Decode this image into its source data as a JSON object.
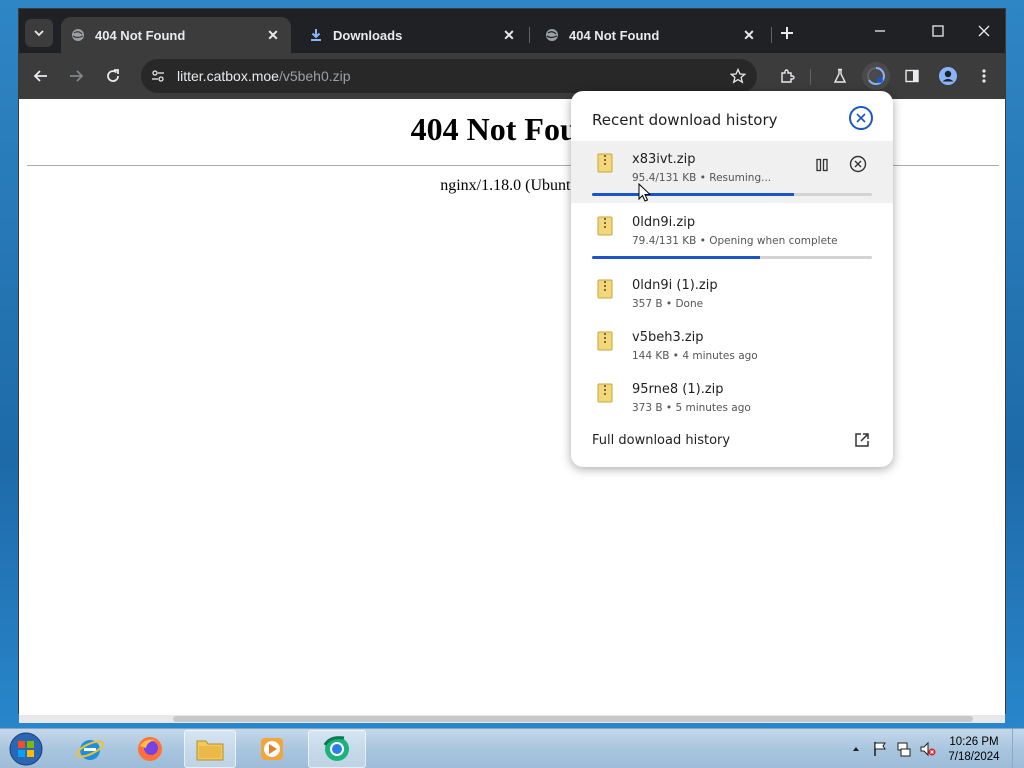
{
  "tabs": [
    {
      "title": "404 Not Found",
      "active": true,
      "favicon": "globe-icon"
    },
    {
      "title": "Downloads",
      "active": false,
      "favicon": "download-icon"
    },
    {
      "title": "404 Not Found",
      "active": false,
      "favicon": "globe-icon"
    }
  ],
  "omnibox": {
    "host": "litter.catbox.moe",
    "path": "/v5beh0.zip"
  },
  "page": {
    "heading": "404 Not Found",
    "server": "nginx/1.18.0 (Ubuntu)"
  },
  "downloads": {
    "title": "Recent download history",
    "items": [
      {
        "name": "x83ivt.zip",
        "status": "95.4/131 KB • Resuming...",
        "progress": 0.72,
        "hover": true
      },
      {
        "name": "0ldn9i.zip",
        "status": "79.4/131 KB • Opening when complete",
        "progress": 0.6
      },
      {
        "name": "0ldn9i (1).zip",
        "status": "357 B • Done"
      },
      {
        "name": "v5beh3.zip",
        "status": "144 KB • 4 minutes ago"
      },
      {
        "name": "95rne8 (1).zip",
        "status": "373 B • 5 minutes ago"
      }
    ],
    "full_history": "Full download history"
  },
  "taskbar": {
    "apps": [
      "internet-explorer-icon",
      "firefox-icon",
      "file-explorer-icon",
      "media-player-icon",
      "chrome-icon"
    ],
    "time": "10:26 PM",
    "date": "7/18/2024"
  },
  "colors": {
    "accent": "#1a56c9",
    "titlebar": "#202124",
    "toolbar": "#3c3c3c"
  }
}
